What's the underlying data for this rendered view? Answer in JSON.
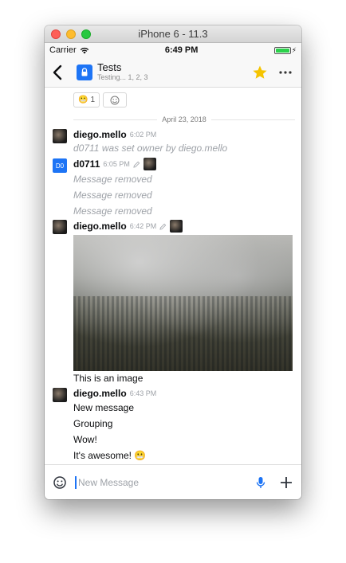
{
  "window": {
    "title": "iPhone 6 - 11.3"
  },
  "status_bar": {
    "carrier": "Carrier",
    "time": "6:49 PM"
  },
  "header": {
    "room_name": "Tests",
    "room_topic": "Testing... 1, 2, 3"
  },
  "reactions": [
    {
      "emoji": "😬",
      "count": "1"
    }
  ],
  "date_separator": "April 23, 2018",
  "messages": {
    "m1": {
      "user": "diego.mello",
      "time": "6:02 PM",
      "system": "d0711 was set owner by diego.mello"
    },
    "m2": {
      "user": "d0711",
      "avatar_initials": "D0",
      "time": "6:05 PM",
      "removed": [
        "Message removed",
        "Message removed",
        "Message removed"
      ]
    },
    "m3": {
      "user": "diego.mello",
      "time": "6:42 PM",
      "caption": "This is an image"
    },
    "m4": {
      "user": "diego.mello",
      "time": "6:43 PM",
      "lines": [
        "New message",
        "Grouping",
        "Wow!",
        "It's awesome! 😬"
      ]
    }
  },
  "composer": {
    "placeholder": "New Message"
  },
  "colors": {
    "accent": "#1d74f5",
    "star": "#f5c400",
    "battery": "#2bd24b"
  }
}
